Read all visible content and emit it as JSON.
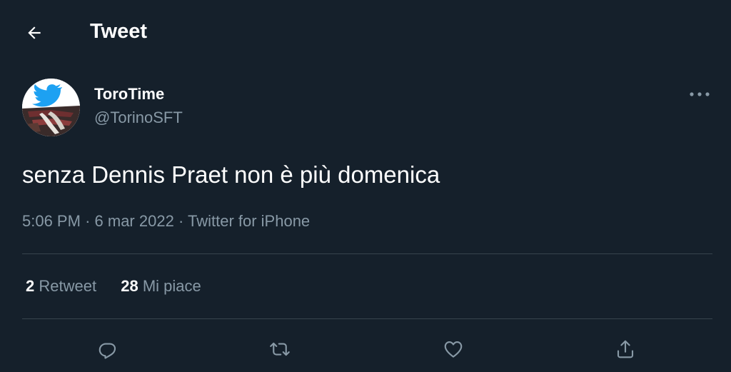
{
  "header": {
    "title": "Tweet",
    "back_icon": "arrow-left-icon"
  },
  "author": {
    "display_name": "ToroTime",
    "handle": "@TorinoSFT",
    "avatar_icon": "twitter-bird-icon"
  },
  "tweet": {
    "text": "senza Dennis Praet non è più domenica",
    "time": "5:06 PM",
    "separator": "·",
    "date": "6 mar 2022",
    "source": "Twitter for iPhone"
  },
  "stats": {
    "retweets_count": "2",
    "retweets_label": "Retweet",
    "likes_count": "28",
    "likes_label": "Mi piace"
  },
  "actions": [
    "reply-icon",
    "retweet-icon",
    "like-icon",
    "share-icon"
  ],
  "colors": {
    "background": "#15202b",
    "text_primary": "#ffffff",
    "text_secondary": "#8899a6",
    "divider": "#38444d",
    "twitter_blue": "#1da1f2"
  }
}
